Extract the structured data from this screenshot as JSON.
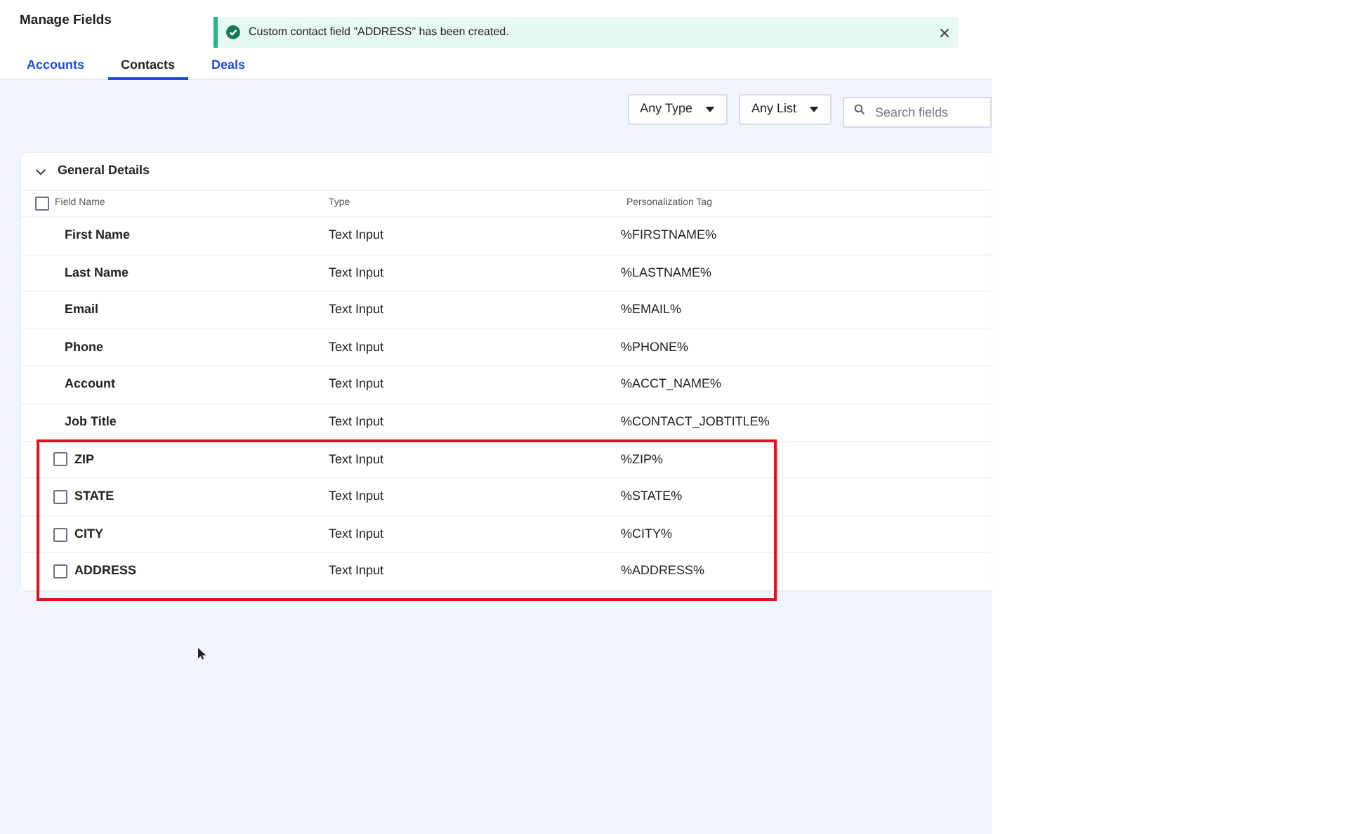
{
  "page": {
    "title": "Manage Fields"
  },
  "toast": {
    "message": "Custom contact field \"ADDRESS\" has been created."
  },
  "tabs": [
    {
      "label": "Accounts",
      "selected": false
    },
    {
      "label": "Contacts",
      "selected": true
    },
    {
      "label": "Deals",
      "selected": false
    }
  ],
  "filters": {
    "type": "Any Type",
    "list": "Any List",
    "search": {
      "placeholder": "Search fields"
    }
  },
  "section": {
    "title": "General Details",
    "expanded": true,
    "columns": [
      "Field Name",
      "Type",
      "Personalization Tag"
    ],
    "select_all": {
      "checked": false
    },
    "rows": [
      {
        "kind": "system",
        "name": "First Name",
        "type": "Text Input",
        "tag": "%FIRSTNAME%"
      },
      {
        "kind": "system",
        "name": "Last Name",
        "type": "Text Input",
        "tag": "%LASTNAME%"
      },
      {
        "kind": "system",
        "name": "Email",
        "type": "Text Input",
        "tag": "%EMAIL%"
      },
      {
        "kind": "system",
        "name": "Phone",
        "type": "Text Input",
        "tag": "%PHONE%"
      },
      {
        "kind": "system",
        "name": "Account",
        "type": "Text Input",
        "tag": "%ACCT_NAME%"
      },
      {
        "kind": "system",
        "name": "Job Title",
        "type": "Text Input",
        "tag": "%CONTACT_JOBTITLE%"
      },
      {
        "kind": "custom",
        "name": "ZIP",
        "type": "Text Input",
        "tag": "%ZIP%",
        "checked": false
      },
      {
        "kind": "custom",
        "name": "STATE",
        "type": "Text Input",
        "tag": "%STATE%",
        "checked": false
      },
      {
        "kind": "custom",
        "name": "CITY",
        "type": "Text Input",
        "tag": "%CITY%",
        "checked": false
      },
      {
        "kind": "custom",
        "name": "ADDRESS",
        "type": "Text Input",
        "tag": "%ADDRESS%",
        "checked": false
      }
    ]
  }
}
